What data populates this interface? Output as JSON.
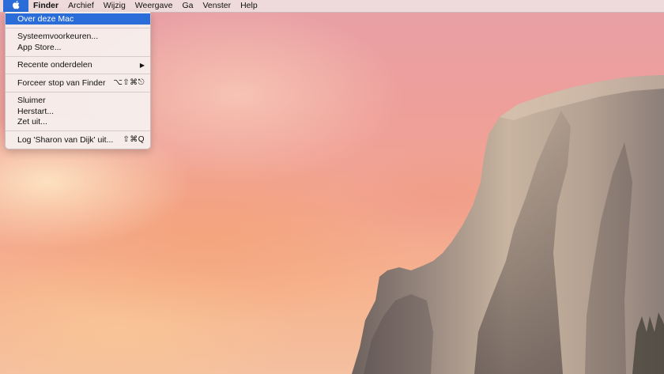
{
  "menubar": {
    "apple_icon": "apple-logo-icon",
    "items": [
      {
        "label": "Finder",
        "bold": true
      },
      {
        "label": "Archief"
      },
      {
        "label": "Wijzig"
      },
      {
        "label": "Weergave"
      },
      {
        "label": "Ga"
      },
      {
        "label": "Venster"
      },
      {
        "label": "Help"
      }
    ]
  },
  "apple_menu": {
    "highlight_color": "#2a6cd8",
    "items": {
      "about": {
        "label": "Over deze Mac"
      },
      "system_prefs": {
        "label": "Systeemvoorkeuren..."
      },
      "app_store": {
        "label": "App Store..."
      },
      "recent": {
        "label": "Recente onderdelen",
        "arrow": "▶"
      },
      "force_quit": {
        "label": "Forceer stop van Finder",
        "shortcut": "⌥⇧⌘⎋"
      },
      "sleep": {
        "label": "Sluimer"
      },
      "restart": {
        "label": "Herstart..."
      },
      "shutdown": {
        "label": "Zet uit..."
      },
      "logout": {
        "label": "Log 'Sharon van Dijk' uit...",
        "shortcut": "⇧⌘Q"
      }
    }
  },
  "wallpaper": {
    "sky_colors": [
      "#e8a0a6",
      "#f3a58f",
      "#f4c0a0"
    ],
    "rock_color": "#8a7e76"
  }
}
